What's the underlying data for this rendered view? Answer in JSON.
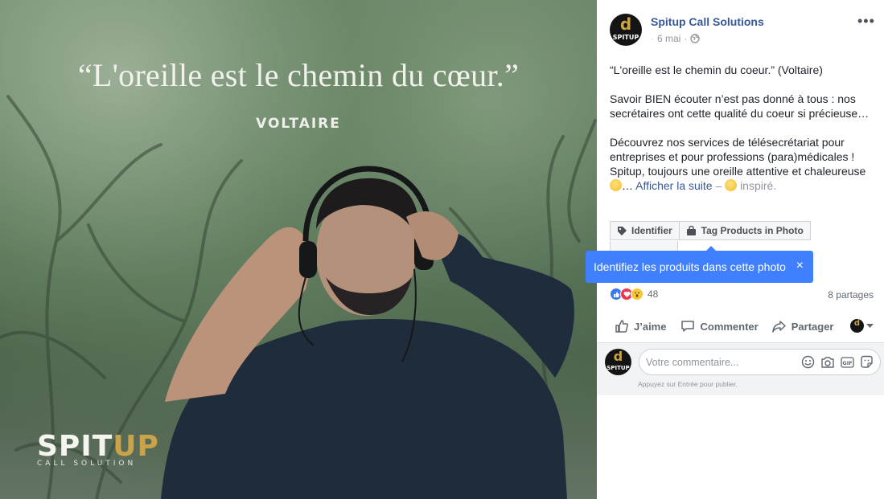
{
  "photo": {
    "quote": "“L'oreille est le chemin du cœur.”",
    "author": "VOLTAIRE",
    "watermark_main_a": "SPIT",
    "watermark_main_b": "UP",
    "watermark_sub": "CALL SOLUTION",
    "brand_gold": "#c9a24a"
  },
  "post": {
    "page_name": "Spitup Call Solutions",
    "date": "6 mai",
    "privacy_icon": "globe-icon",
    "more_label": "•••",
    "avatar_letter": "d",
    "avatar_text": "SPITUP",
    "text_p1": "“L'oreille est le chemin du coeur.” (Voltaire)",
    "text_p2": "Savoir BIEN écouter n’est pas donné à tous : nos secrétaires ont cette qualité du coeur si précieuse…",
    "text_p3": "Découvrez nos services de télésecrétariat pour entreprises et pour professions (para)médicales ! Spitup, toujours une oreille attentive et chaleureuse",
    "ellipsis": "…",
    "see_more": "Afficher la suite",
    "dash": " – ",
    "feeling": "inspiré."
  },
  "tag_buttons": {
    "identify": "Identifier",
    "tag_products": "Tag Products in Photo"
  },
  "tooltip": {
    "text": "Identifiez les produits dans cette photo",
    "close": "×"
  },
  "reactions": {
    "count": "48",
    "shares": "8 partages",
    "like_color": "#3b79f0",
    "love_color": "#f0364f",
    "wow_color": "#f7c73a"
  },
  "actions": {
    "like": "J’aime",
    "comment": "Commenter",
    "share": "Partager"
  },
  "comment_box": {
    "placeholder": "Votre commentaire...",
    "hint": "Appuyez sur Entrée pour publier.",
    "gif_label": "GIF"
  },
  "colors": {
    "link_blue": "#385898",
    "tooltip_blue": "#4080ff"
  }
}
